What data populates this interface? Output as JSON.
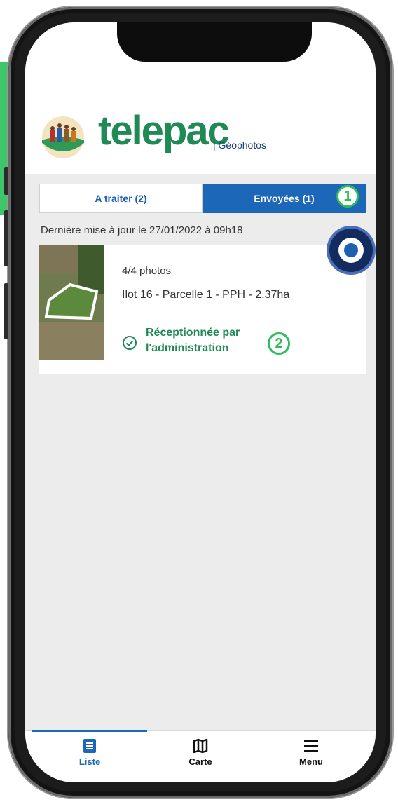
{
  "brand": {
    "name": "telepac",
    "subtitle": "| Géophotos",
    "color": "#1f8a55"
  },
  "tabs": [
    {
      "label": "A traiter (2)",
      "active": false
    },
    {
      "label": "Envoyées (1)",
      "active": true
    }
  ],
  "annotations": [
    "1",
    "2"
  ],
  "last_update": "Dernière mise à jour le 27/01/2022 à 09h18",
  "item": {
    "photos": "4/4 photos",
    "parcel": "Ilot 16 - Parcelle 1 - PPH - 2.37ha",
    "status_line1": "Réceptionnée par",
    "status_line2": "l'administration",
    "status_icon": "check-circle-icon"
  },
  "nav": [
    {
      "label": "Liste",
      "icon": "list-icon",
      "active": true
    },
    {
      "label": "Carte",
      "icon": "map-icon",
      "active": false
    },
    {
      "label": "Menu",
      "icon": "hamburger-menu-icon",
      "active": false
    }
  ],
  "colors": {
    "accent_blue": "#1d67b8",
    "annotation_green": "#2fbd5c",
    "screen_bg": "#ececec"
  }
}
